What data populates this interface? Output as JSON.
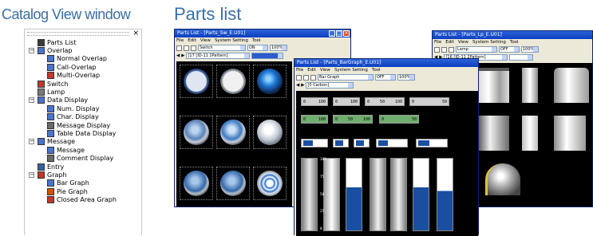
{
  "headings": {
    "catalog": "Catalog View window",
    "parts": "Parts list"
  },
  "catalog": {
    "close_glyph": "×",
    "items": [
      {
        "label": "Parts List",
        "icon": "parts-list-icon",
        "level": 0,
        "expander": ""
      },
      {
        "label": "Overlap",
        "icon": "overlap-icon",
        "level": 0,
        "expander": "−"
      },
      {
        "label": "Normal Overlap",
        "icon": "normal-overlap-icon",
        "level": 1,
        "expander": ""
      },
      {
        "label": "Call-Overlap",
        "icon": "call-overlap-icon",
        "level": 1,
        "expander": ""
      },
      {
        "label": "Multi-Overlap",
        "icon": "multi-overlap-icon",
        "level": 1,
        "expander": ""
      },
      {
        "label": "Switch",
        "icon": "switch-icon",
        "level": 0,
        "expander": ""
      },
      {
        "label": "Lamp",
        "icon": "lamp-icon",
        "level": 0,
        "expander": ""
      },
      {
        "label": "Data Display",
        "icon": "data-display-icon",
        "level": 0,
        "expander": "−"
      },
      {
        "label": "Num. Display",
        "icon": "num-display-icon",
        "level": 1,
        "expander": ""
      },
      {
        "label": "Char. Display",
        "icon": "char-display-icon",
        "level": 1,
        "expander": ""
      },
      {
        "label": "Message Display",
        "icon": "message-display-icon",
        "level": 1,
        "expander": ""
      },
      {
        "label": "Table Data Display",
        "icon": "table-data-display-icon",
        "level": 1,
        "expander": ""
      },
      {
        "label": "Message",
        "icon": "message-icon",
        "level": 0,
        "expander": "−"
      },
      {
        "label": "Message",
        "icon": "message-sub-icon",
        "level": 1,
        "expander": ""
      },
      {
        "label": "Comment Display",
        "icon": "comment-display-icon",
        "level": 1,
        "expander": ""
      },
      {
        "label": "Entry",
        "icon": "entry-icon",
        "level": 0,
        "expander": ""
      },
      {
        "label": "Graph",
        "icon": "graph-icon",
        "level": 0,
        "expander": "−"
      },
      {
        "label": "Bar Graph",
        "icon": "bar-graph-icon",
        "level": 1,
        "expander": ""
      },
      {
        "label": "Pie Graph",
        "icon": "pie-graph-icon",
        "level": 1,
        "expander": ""
      },
      {
        "label": "Closed Area Graph",
        "icon": "closed-area-graph-icon",
        "level": 1,
        "expander": ""
      }
    ]
  },
  "windows": {
    "switch": {
      "title": "Parts List - [Parts_Sw_E.U01]",
      "menu": [
        "File",
        "Edit",
        "View",
        "System Setting",
        "Tool"
      ],
      "category": "Switch",
      "state": "ON",
      "zoom": "100%",
      "pattern": "[17 [ID-11 2Pattern]"
    },
    "bargraph": {
      "title": "Parts List - [Parts_BarGraph_E.U01]",
      "menu": [
        "File",
        "Edit",
        "View",
        "System Setting",
        "Tool"
      ],
      "category": "Bar Graph",
      "state": "OFF",
      "zoom": "100%",
      "pattern": "[0 Carbon]"
    },
    "lamp": {
      "title": "Parts List - [Parts_Lp_E.U01]",
      "menu": [
        "File",
        "Edit",
        "View",
        "System Setting",
        "Tool"
      ],
      "category": "Lamp",
      "state": "OFF",
      "zoom": "100%",
      "pattern": "[16 [ID-11 2Pattern]"
    }
  },
  "bargraph_labels": {
    "h_rows": [
      [
        "0",
        "100",
        "0",
        "100",
        "0",
        "50",
        "100",
        "0",
        "50"
      ],
      [
        "0",
        "100",
        "0",
        "50",
        "100",
        "0",
        "50"
      ]
    ],
    "v_ticks": [
      "100",
      "75",
      "50",
      "25",
      "0"
    ]
  },
  "colors": {
    "heading": "#3a6ea5",
    "titlebar": "#0a3ec0",
    "bar_fill": "#1a4fa0"
  }
}
